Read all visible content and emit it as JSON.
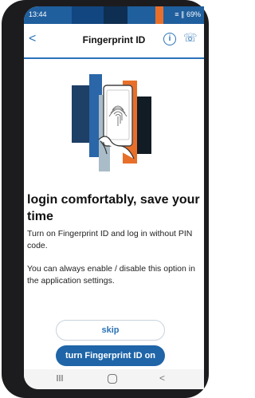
{
  "status": {
    "time": "13:44",
    "battery": "69%",
    "signal": "≡ ∥"
  },
  "header": {
    "back": "<",
    "title": "Fingerprint ID",
    "info": "i",
    "phone": "☏"
  },
  "content": {
    "headline": "login comfortably, save your time",
    "para1": "Turn on Fingerprint ID and log in without PIN code.",
    "para2": "You can always enable / disable this option in the application settings."
  },
  "buttons": {
    "skip": "skip",
    "turn_on": "turn Fingerprint ID on"
  },
  "nav": {
    "back": "<"
  },
  "colors": {
    "accent": "#2a73b8",
    "primary_button": "#1f65a8",
    "status_bar": "#1f5f9e"
  }
}
